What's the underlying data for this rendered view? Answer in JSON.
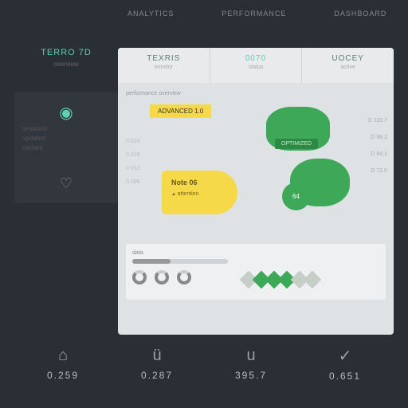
{
  "header": {
    "items": [
      "ANALYTICS",
      "PERFORMANCE",
      "DASHBOARD"
    ]
  },
  "sidebar": {
    "title": "TERRO 7D",
    "subtitle": "overview",
    "stat1": {
      "l1": "sessions",
      "l2": "updated",
      "l3": "cached"
    }
  },
  "tabs": [
    {
      "title": "TEXRIS",
      "sub": "monitor"
    },
    {
      "title": "0070",
      "sub": "status"
    },
    {
      "title": "UOCEY",
      "sub": "active"
    }
  ],
  "canvas": {
    "topLabel": "performance overview",
    "badge": "ADVANCED 1.0",
    "greenLabel": "OPTIMIZED",
    "greenSmall": "64",
    "popup": {
      "title": "Note 06",
      "sub": "attention"
    },
    "sideStats": [
      "D 110.7",
      "D 98.2",
      "D 84.1",
      "D 72.0"
    ],
    "leftStats": [
      "0.024",
      "0.018",
      "0.012",
      "0.006"
    ],
    "bpLabel": "data"
  },
  "footer": [
    {
      "icon": "⌂",
      "val": "0.259"
    },
    {
      "icon": "ü",
      "val": "0.287"
    },
    {
      "icon": "u",
      "val": "395.7"
    },
    {
      "icon": "✓",
      "val": "0.651"
    }
  ]
}
